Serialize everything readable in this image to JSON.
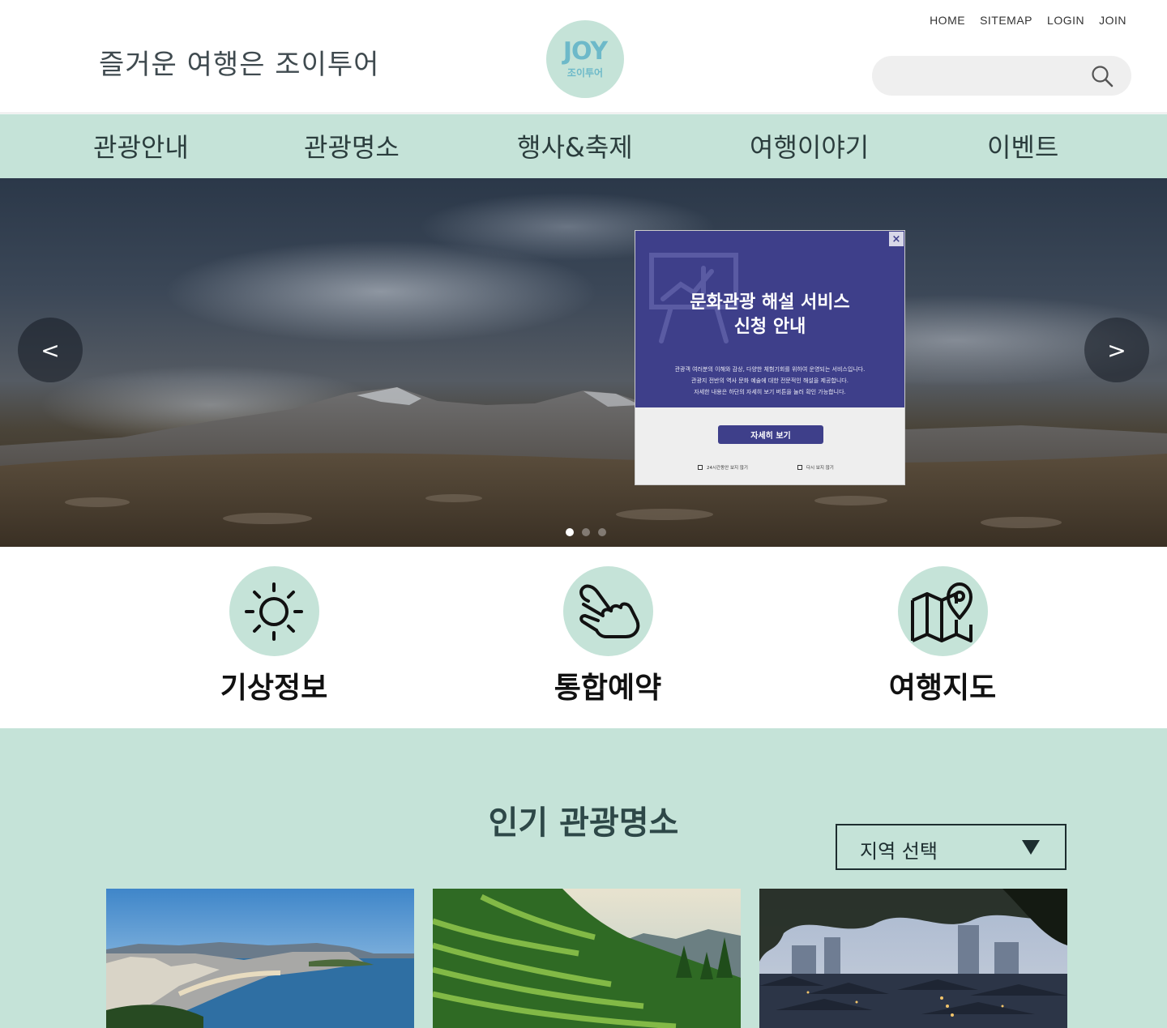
{
  "header": {
    "tagline": "즐거운 여행은 조이투어",
    "logo": {
      "main": "JOY",
      "sub": "조이투어"
    },
    "topnav": [
      "HOME",
      "SITEMAP",
      "LOGIN",
      "JOIN"
    ],
    "search": {
      "placeholder": "",
      "icon": "search-icon"
    }
  },
  "mainnav": [
    "관광안내",
    "관광명소",
    "행사&축제",
    "여행이야기",
    "이벤트"
  ],
  "hero": {
    "prev_label": "<",
    "next_label": ">",
    "slide_count": 3,
    "active_slide": 1
  },
  "popup": {
    "close_label": "×",
    "title_line1": "문화관광 해설 서비스",
    "title_line2": "신청 안내",
    "desc_line1": "관광객 여러분의 이해와 감상, 다양한 체험기회를 위하여 운영되는 서비스입니다.",
    "desc_line2": "관광지 전반의 역사 문화 예술에 대한 전문적인 해설을 제공합니다.",
    "desc_line3": "자세한 내용은 하단의 자세히 보기 버튼을 눌러 확인 가능합니다.",
    "button": "자세히 보기",
    "check1": "24시간동안 보지 않기",
    "check2": "다시 보지 않기"
  },
  "quicklinks": [
    {
      "label": "기상정보",
      "icon": "sun-icon"
    },
    {
      "label": "통합예약",
      "icon": "tap-hand-icon"
    },
    {
      "label": "여행지도",
      "icon": "map-pin-icon"
    }
  ],
  "popular": {
    "title": "인기 관광명소",
    "region_select": "지역 선택"
  },
  "colors": {
    "mint": "#c5e3d8",
    "popup_purple": "#3e3f8a",
    "dark_text": "#2e4848"
  }
}
